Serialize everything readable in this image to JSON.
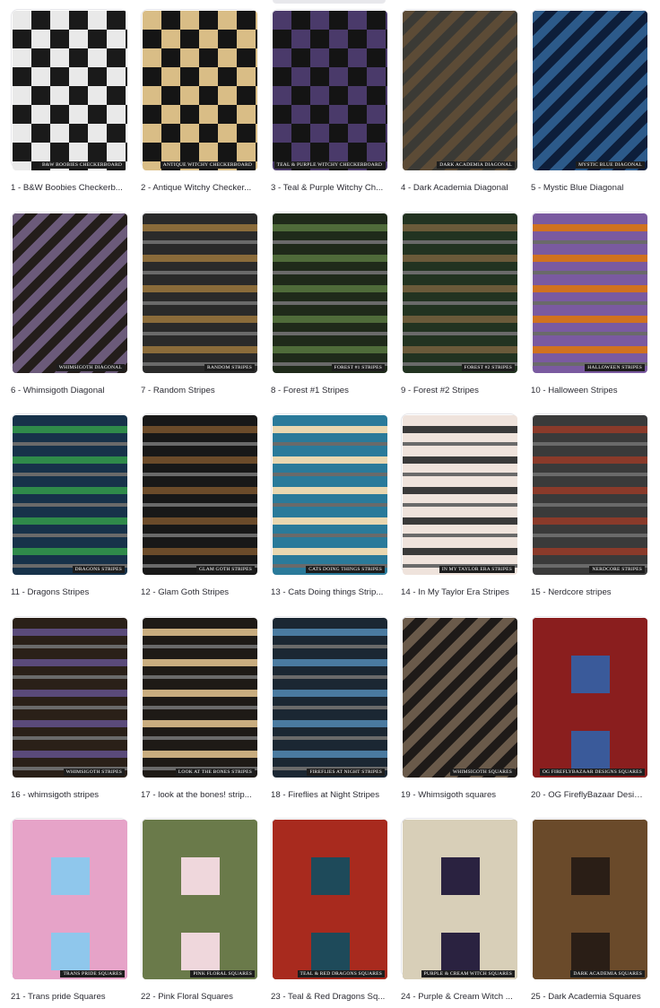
{
  "items": [
    {
      "caption": "1 - B&W Boobies Checkerb...",
      "label": "B&W Boobies Checkerboard",
      "style": "check",
      "c1": "#1a1a1a",
      "c2": "#e9e9e9"
    },
    {
      "caption": "2 - Antique Witchy Checker...",
      "label": "Antique Witchy Checkerboard",
      "style": "check",
      "c1": "#151515",
      "c2": "#d9bd86"
    },
    {
      "caption": "3 - Teal & Purple Witchy Ch...",
      "label": "Teal & Purple Witchy Checkerboard",
      "style": "check",
      "c1": "#141414",
      "c2": "#4a3a6a"
    },
    {
      "caption": "4 - Dark Academia Diagonal",
      "label": "Dark Academia Diagonal",
      "style": "mosaic",
      "c1": "#3b3a35",
      "c2": "#5c4b36"
    },
    {
      "caption": "5 - Mystic Blue Diagonal",
      "label": "Mystic Blue Diagonal",
      "style": "mosaic",
      "c1": "#0d1e3a",
      "c2": "#2c5a8a"
    },
    {
      "caption": "6 - Whimsigoth Diagonal",
      "label": "Whimsigoth Diagonal",
      "style": "mosaic",
      "c1": "#231d1a",
      "c2": "#6b5a7a"
    },
    {
      "caption": "7 - Random Stripes",
      "label": "Random Stripes",
      "style": "stripes",
      "c1": "#2a2a2a",
      "c2": "#8a6b3a"
    },
    {
      "caption": "8 - Forest #1 Stripes",
      "label": "Forest #1 Stripes",
      "style": "stripes",
      "c1": "#1f2a1a",
      "c2": "#4f6b3a"
    },
    {
      "caption": "9 - Forest #2 Stripes",
      "label": "Forest #2 Stripes",
      "style": "stripes",
      "c1": "#223321",
      "c2": "#6a5a3a"
    },
    {
      "caption": "10 - Halloween Stripes",
      "label": "Halloween Stripes",
      "style": "stripes",
      "c1": "#7a5aa0",
      "c2": "#d0721f"
    },
    {
      "caption": "11 - Dragons Stripes",
      "label": "Dragons Stripes",
      "style": "stripes",
      "c1": "#17324a",
      "c2": "#2f8a4a"
    },
    {
      "caption": "12 - Glam Goth Stripes",
      "label": "Glam Goth Stripes",
      "style": "stripes",
      "c1": "#181818",
      "c2": "#6b4b2a"
    },
    {
      "caption": "13 - Cats Doing things Strip...",
      "label": "Cats Doing Things Stripes",
      "style": "stripes",
      "c1": "#2a7a9a",
      "c2": "#e9d7b0"
    },
    {
      "caption": "14 - In My Taylor Era Stripes",
      "label": "In My Taylor Era Stripes",
      "style": "stripes",
      "c1": "#efe3dc",
      "c2": "#3a3a3a"
    },
    {
      "caption": "15 - Nerdcore stripes",
      "label": "Nerdcore Stripes",
      "style": "stripes",
      "c1": "#3a3a3a",
      "c2": "#8a3a2a"
    },
    {
      "caption": "16 - whimsigoth stripes",
      "label": "Whimsigoth Stripes",
      "style": "stripes",
      "c1": "#2a2018",
      "c2": "#5a4a7a"
    },
    {
      "caption": "17 - look at the bones! strip...",
      "label": "Look at the Bones Stripes",
      "style": "stripes",
      "c1": "#1e1a16",
      "c2": "#c9ad7f"
    },
    {
      "caption": "18 - Fireflies at Night Stripes",
      "label": "Fireflies at Night Stripes",
      "style": "stripes",
      "c1": "#1b2733",
      "c2": "#4a7aa0"
    },
    {
      "caption": "19 - Whimsigoth squares",
      "label": "Whimsigoth Squares",
      "style": "mosaic",
      "c1": "#1e1a18",
      "c2": "#6a5a4a"
    },
    {
      "caption": "20 - OG FireflyBazaar Desig...",
      "label": "OG FireflyBazaar Designs Squares",
      "style": "squares",
      "c1": "#3a5a9a",
      "c2": "#8a1e1e"
    },
    {
      "caption": "21 - Trans pride Squares",
      "label": "Trans Pride Squares",
      "style": "squares",
      "c1": "#8fc7ec",
      "c2": "#e6a3c8"
    },
    {
      "caption": "22 - Pink Floral Squares",
      "label": "Pink Floral Squares",
      "style": "squares",
      "c1": "#efd7dc",
      "c2": "#6a7a4a"
    },
    {
      "caption": "23 - Teal & Red Dragons Sq...",
      "label": "Teal & Red Dragons Squares",
      "style": "squares",
      "c1": "#1e4a5a",
      "c2": "#a82a1e"
    },
    {
      "caption": "24 - Purple & Cream Witch ...",
      "label": "Purple & Cream Witch Squares",
      "style": "squares",
      "c1": "#2a2240",
      "c2": "#d8cfb8"
    },
    {
      "caption": "25 - Dark Academia Squares",
      "label": "Dark Academia Squares",
      "style": "squares",
      "c1": "#2a1e16",
      "c2": "#6a4a2a"
    }
  ]
}
